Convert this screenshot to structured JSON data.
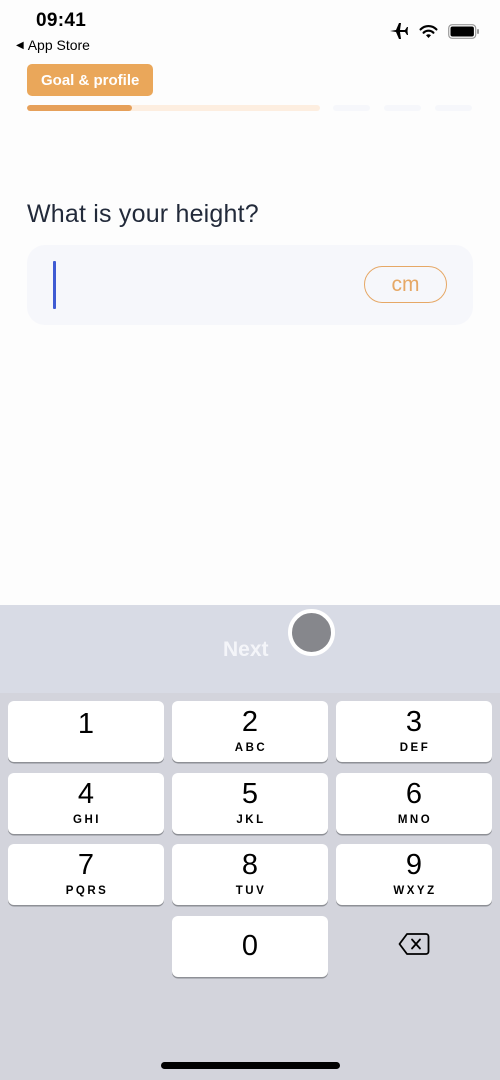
{
  "status_bar": {
    "time": "09:41",
    "back_label": "App Store",
    "back_icon": "back-triangle-icon",
    "icons": [
      "airplane-icon",
      "wifi-icon",
      "battery-icon"
    ]
  },
  "header": {
    "section_badge": "Goal & profile",
    "progress": {
      "segments": 4,
      "current_segment": 1,
      "current_segment_fill_percent": 36
    }
  },
  "main": {
    "question": "What is your height?",
    "height_input": {
      "value": "",
      "placeholder": ""
    },
    "unit_label": "cm"
  },
  "keyboard": {
    "accessory_next_label": "Next",
    "keys": [
      {
        "num": "1",
        "letters": ""
      },
      {
        "num": "2",
        "letters": "ABC"
      },
      {
        "num": "3",
        "letters": "DEF"
      },
      {
        "num": "4",
        "letters": "GHI"
      },
      {
        "num": "5",
        "letters": "JKL"
      },
      {
        "num": "6",
        "letters": "MNO"
      },
      {
        "num": "7",
        "letters": "PQRS"
      },
      {
        "num": "8",
        "letters": "TUV"
      },
      {
        "num": "9",
        "letters": "WXYZ"
      },
      {
        "num": "0",
        "letters": ""
      }
    ],
    "backspace_icon": "backspace-icon"
  },
  "colors": {
    "accent_orange": "#eaa75a",
    "progress_fill": "#e6a05a",
    "caret_blue": "#3f5bd3",
    "text_dark": "#222a3a"
  }
}
